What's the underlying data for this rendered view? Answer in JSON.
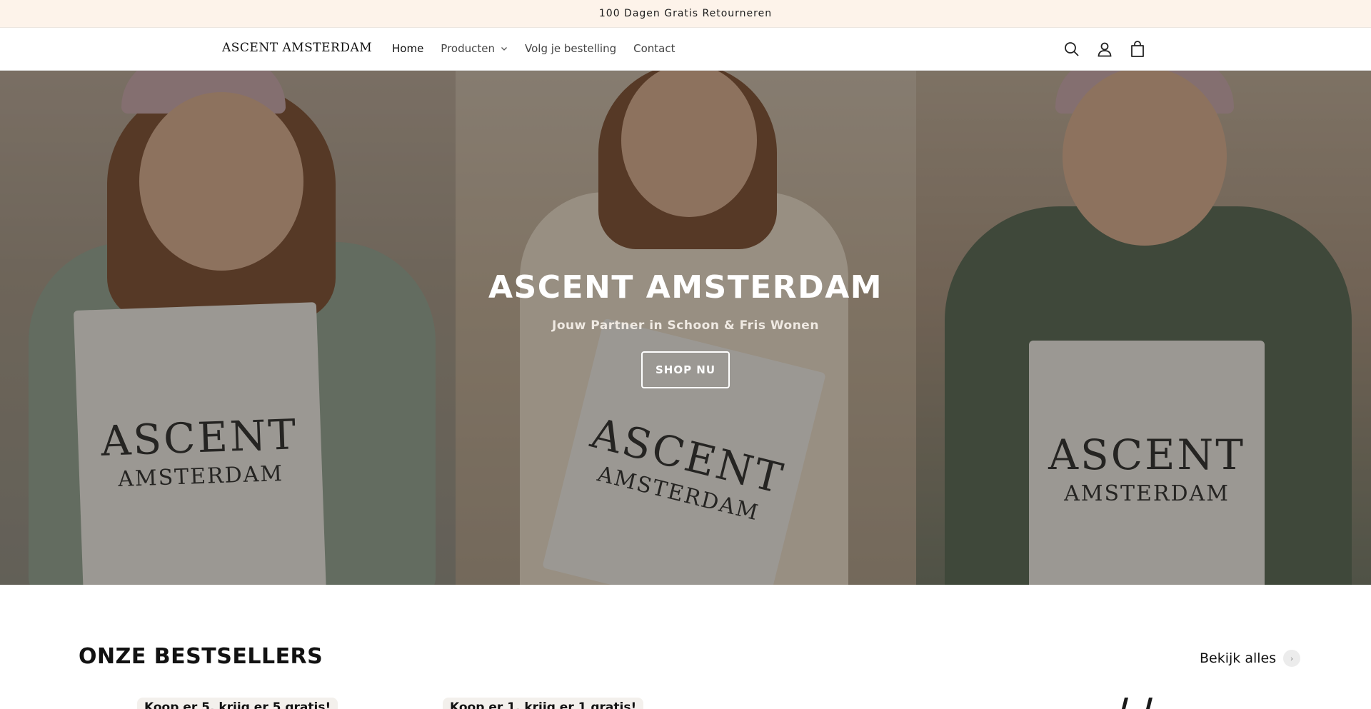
{
  "announcement": {
    "text": "100 Dagen Gratis Retourneren"
  },
  "header": {
    "logo": "ASCENT AMSTERDAM",
    "nav": [
      {
        "label": "Home",
        "active": true
      },
      {
        "label": "Producten",
        "has_dropdown": true
      },
      {
        "label": "Volg je bestelling"
      },
      {
        "label": "Contact"
      }
    ],
    "icons": [
      "search-icon",
      "account-icon",
      "cart-icon"
    ]
  },
  "hero": {
    "title": "ASCENT AMSTERDAM",
    "subtitle": "Jouw Partner in Schoon & Fris Wonen",
    "button": "SHOP NU",
    "bag_text_line1": "ASCENT",
    "bag_text_line2": "AMSTERDAM"
  },
  "bestsellers": {
    "title": "ONZE BESTSELLERS",
    "view_all": "Bekijk alles",
    "promos": [
      "Koop er 5, krijg er 5 gratis!",
      "Koop er 1, krijg er 1 gratis!"
    ]
  },
  "colors": {
    "announcement_bg": "#fdf3ea",
    "text": "#121212",
    "hero_button_border": "#ffffff"
  }
}
